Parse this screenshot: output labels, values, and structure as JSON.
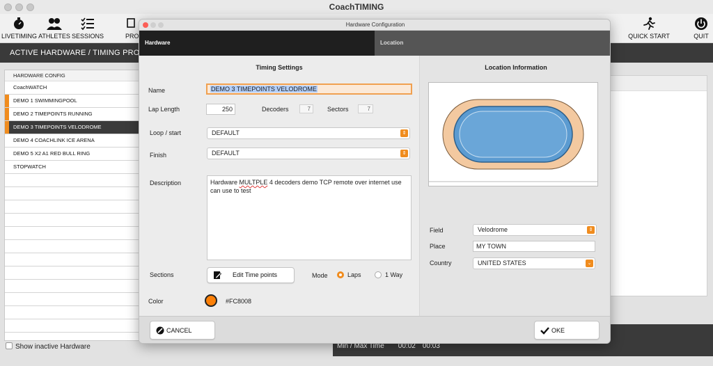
{
  "app": {
    "title": "CoachTIMING"
  },
  "toolbar": {
    "items": [
      {
        "label": "LIVETIMING",
        "icon": "stopwatch-icon"
      },
      {
        "label": "ATHLETES",
        "icon": "athletes-icon"
      },
      {
        "label": "SESSIONS",
        "icon": "sessions-list-icon"
      },
      {
        "label": "PRO",
        "icon": "pro-icon"
      },
      {
        "label": "QUICK START",
        "icon": "runner-icon"
      },
      {
        "label": "QUIT",
        "icon": "power-icon"
      }
    ]
  },
  "section": {
    "title": "ACTIVE HARDWARE / TIMING PROFILES"
  },
  "hardware_list": {
    "header": "HARDWARE CONFIG",
    "rows": [
      {
        "label": "CoachWATCH",
        "marked": false,
        "selected": false
      },
      {
        "label": "DEMO 1 SWIMMINGPOOL",
        "marked": true,
        "selected": false
      },
      {
        "label": "DEMO 2 TIMEPOINTS RUNNING",
        "marked": true,
        "selected": false
      },
      {
        "label": "DEMO 3 TIMEPOINTS VELODROME",
        "marked": true,
        "selected": true
      },
      {
        "label": "DEMO 4 COACHLINK ICE ARENA",
        "marked": false,
        "selected": false
      },
      {
        "label": "DEMO 5 X2 A1 RED BULL RING",
        "marked": false,
        "selected": false
      },
      {
        "label": "STOPWATCH",
        "marked": false,
        "selected": false
      }
    ]
  },
  "bottom": {
    "show_inactive": "Show inactive Hardware",
    "minmax_label": "Min / Max Time",
    "min_time": "00:02",
    "max_time": "00:03"
  },
  "dialog": {
    "title": "Hardware Configuration",
    "tabs": {
      "hardware": "Hardware",
      "location": "Location"
    },
    "timing": {
      "title": "Timing Settings",
      "name_label": "Name",
      "name_value": "DEMO 3 TIMEPOINTS VELODROME",
      "lap_length_label": "Lap Length",
      "lap_length_value": "250",
      "decoders_label": "Decoders",
      "decoders_value": "7",
      "sectors_label": "Sectors",
      "sectors_value": "7",
      "loop_start_label": "Loop / start",
      "loop_start_value": "DEFAULT",
      "finish_label": "Finish",
      "finish_value": "DEFAULT",
      "description_label": "Description",
      "description_pre": "Hardware ",
      "description_typo": "MULTPLE",
      "description_post": " 4 decoders demo TCP remote over internet use can use to test",
      "sections_label": "Sections",
      "edit_timepoints": "Edit Time points",
      "mode_label": "Mode",
      "mode_laps": "Laps",
      "mode_oneway": "1 Way",
      "mode_selected": "Laps",
      "color_label": "Color",
      "color_value": "#FC8008"
    },
    "location": {
      "title": "Location Information",
      "field_label": "Field",
      "field_value": "Velodrome",
      "place_label": "Place",
      "place_value": "MY TOWN",
      "country_label": "Country",
      "country_value": "UNITED STATES"
    },
    "buttons": {
      "cancel": "CANCEL",
      "ok": "OKE"
    }
  },
  "colors": {
    "accent": "#f08c1e",
    "dark": "#232323",
    "track_outer": "#f3c9a0",
    "track_inner": "#5b9bd1"
  }
}
